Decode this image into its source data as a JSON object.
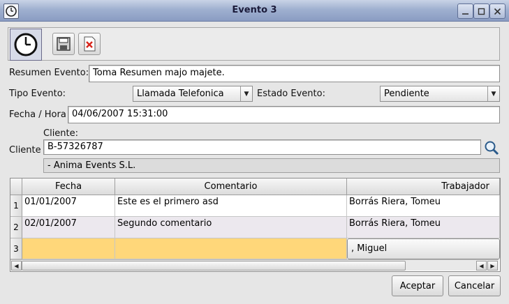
{
  "window": {
    "title": "Evento 3"
  },
  "form": {
    "resumen_label": "Resumen Evento:",
    "resumen_value": "Toma Resumen majo majete.",
    "tipo_label": "Tipo Evento:",
    "tipo_value": "Llamada Telefonica",
    "estado_label": "Estado Evento:",
    "estado_value": "Pendiente",
    "fecha_label": "Fecha / Hora",
    "fecha_value": "04/06/2007 15:31:00",
    "cliente_label": "Cliente",
    "cliente_sublabel": "Cliente:",
    "cliente_value": "B-57326787",
    "cliente_name": "- Anima Events S.L."
  },
  "table": {
    "columns": [
      "Fecha",
      "Comentario",
      "Trabajador"
    ],
    "rows": [
      {
        "num": "1",
        "fecha": "01/01/2007",
        "comentario": "Este es el primero asd",
        "trabajador": "Borrás Riera, Tomeu"
      },
      {
        "num": "2",
        "fecha": "02/01/2007",
        "comentario": "Segundo comentario",
        "trabajador": "Borrás Riera, Tomeu"
      },
      {
        "num": "3",
        "fecha": "",
        "comentario": "",
        "trabajador": ", Miguel"
      }
    ]
  },
  "buttons": {
    "accept_label": "Aceptar",
    "cancel_label": "Cancelar"
  },
  "colors": {
    "editing_row": "#ffd77a",
    "alt_row": "#ece8ee"
  },
  "icons": [
    "clock-icon",
    "save-icon",
    "delete-icon",
    "search-icon",
    "minimize-icon",
    "maximize-icon",
    "close-icon"
  ]
}
